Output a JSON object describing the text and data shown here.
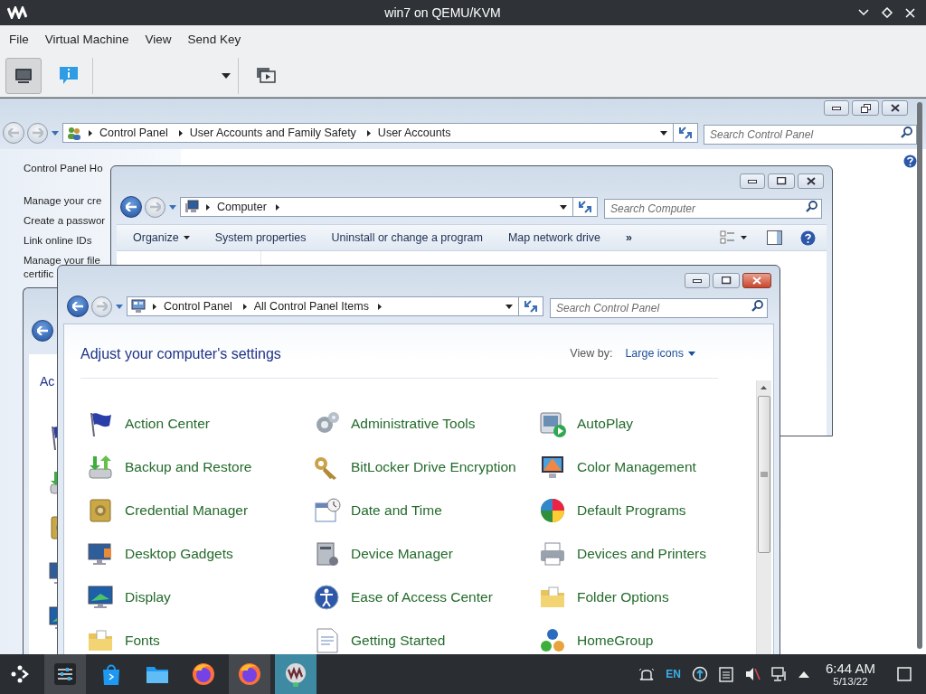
{
  "vm_window": {
    "title": "win7 on QEMU/KVM"
  },
  "menu": [
    "File",
    "Virtual Machine",
    "View",
    "Send Key"
  ],
  "toolbar": {
    "buttons": [
      {
        "kind": "console",
        "selected": true
      },
      {
        "kind": "details",
        "selected": false
      },
      {
        "kind": "snapshots",
        "selected": false
      }
    ]
  },
  "user_accounts_window": {
    "active": false,
    "maximized": true,
    "back_enabled": false,
    "breadcrumb": [
      "Control Panel",
      "User Accounts and Family Safety",
      "User Accounts"
    ],
    "more_arrow": false,
    "search": {
      "placeholder": "Search Control Panel"
    },
    "links": [
      {
        "lines": [
          "Control Panel Ho"
        ]
      },
      {
        "lines": [
          "Manage your cre"
        ]
      },
      {
        "lines": [
          "Create a passwor"
        ]
      },
      {
        "lines": [
          "Link online IDs"
        ]
      },
      {
        "lines": [
          "Manage your file",
          "certific"
        ]
      }
    ]
  },
  "computer_window": {
    "active": false,
    "maximized": false,
    "back_enabled": true,
    "breadcrumb": [
      "Computer"
    ],
    "more_arrow": true,
    "search": {
      "placeholder": "Search Computer"
    },
    "commands": [
      {
        "label": "Organize",
        "dropdown": true
      },
      {
        "label": "System properties",
        "dropdown": false
      },
      {
        "label": "Uninstall or change a program",
        "dropdown": false
      },
      {
        "label": "Map network drive",
        "dropdown": false
      },
      {
        "label": "»",
        "dropdown": false
      }
    ]
  },
  "hidden_window": {
    "back_enabled": true,
    "heading": "Ac"
  },
  "control_panel_window": {
    "active": true,
    "maximized": false,
    "back_enabled": true,
    "breadcrumb": [
      "Control Panel",
      "All Control Panel Items"
    ],
    "more_arrow": true,
    "search": {
      "placeholder": "Search Control Panel"
    },
    "heading": "Adjust your computer's settings",
    "view_by_label": "View by:",
    "view_by_value": "Large icons",
    "items": [
      {
        "label": "Action Center"
      },
      {
        "label": "Administrative Tools"
      },
      {
        "label": "AutoPlay"
      },
      {
        "label": "Backup and Restore"
      },
      {
        "label": "BitLocker Drive Encryption"
      },
      {
        "label": "Color Management"
      },
      {
        "label": "Credential Manager"
      },
      {
        "label": "Date and Time"
      },
      {
        "label": "Default Programs"
      },
      {
        "label": "Desktop Gadgets"
      },
      {
        "label": "Device Manager"
      },
      {
        "label": "Devices and Printers"
      },
      {
        "label": "Display"
      },
      {
        "label": "Ease of Access Center"
      },
      {
        "label": "Folder Options"
      },
      {
        "label": "Fonts"
      },
      {
        "label": "Getting Started"
      },
      {
        "label": "HomeGroup"
      }
    ]
  },
  "taskbar": {
    "apps": [
      {
        "kind": "settings",
        "open": true,
        "selected": false
      },
      {
        "kind": "store",
        "open": false,
        "selected": false
      },
      {
        "kind": "files",
        "open": false,
        "selected": false
      },
      {
        "kind": "browser",
        "open": false,
        "selected": false
      },
      {
        "kind": "browser",
        "open": true,
        "selected": false
      },
      {
        "kind": "vm",
        "open": true,
        "selected": true
      }
    ],
    "language": "EN",
    "time": "6:44 AM",
    "date": "5/13/22"
  }
}
